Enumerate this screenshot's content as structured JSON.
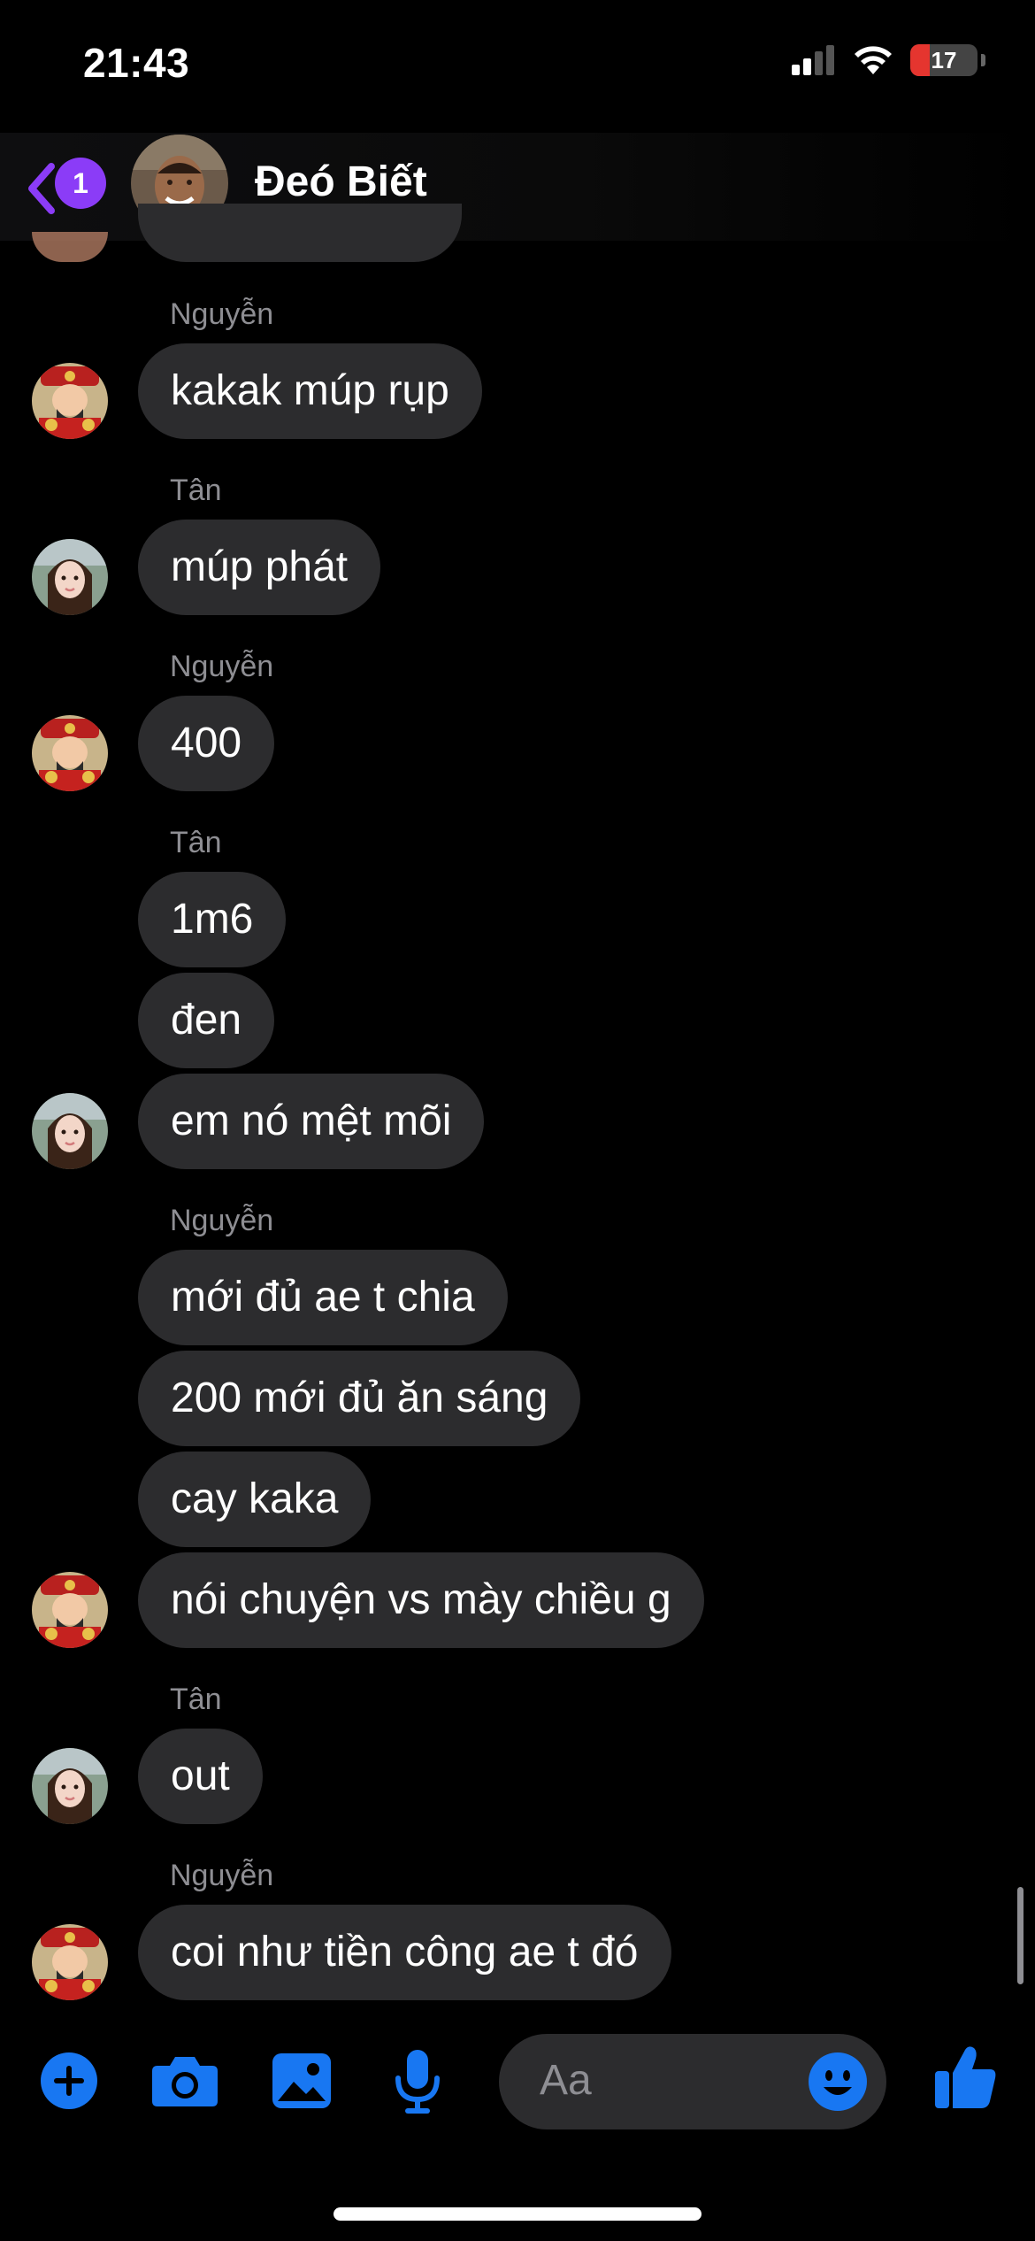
{
  "status_bar": {
    "time": "21:43",
    "battery_level": "17",
    "battery_fraction": 0.17
  },
  "header": {
    "back_badge": "1",
    "contact_name": "Đeó Biết"
  },
  "messages": [
    {
      "sender": "Nguyễn",
      "text": "kakak múp rụp"
    },
    {
      "sender": "Tân",
      "text": "múp phát"
    },
    {
      "sender": "Nguyễn",
      "text": "400"
    },
    {
      "sender": "Tân",
      "text": "1m6"
    },
    {
      "sender": "",
      "text": "đen"
    },
    {
      "sender": "",
      "text": "em nó mệt mõi"
    },
    {
      "sender": "Nguyễn",
      "text": "mới đủ ae t chia"
    },
    {
      "sender": "",
      "text": "200 mới đủ ăn sáng"
    },
    {
      "sender": "",
      "text": "cay kaka"
    },
    {
      "sender": "",
      "text": "nói chuyện vs mày chiều g"
    },
    {
      "sender": "Tân",
      "text": "out"
    },
    {
      "sender": "Nguyễn",
      "text": "coi như tiền công ae t đó"
    }
  ],
  "composer": {
    "placeholder": "Aa"
  },
  "icons": {
    "add": "plus-circle-icon",
    "camera": "camera-icon",
    "gallery": "image-icon",
    "mic": "microphone-icon",
    "emoji": "emoji-icon",
    "like": "thumbs-up-icon",
    "back": "chevron-left-icon"
  },
  "colors": {
    "accent": "#1877f2",
    "badge": "#8b3cf7",
    "bubble": "#2c2c2e",
    "sender_label": "#8e8e93"
  }
}
